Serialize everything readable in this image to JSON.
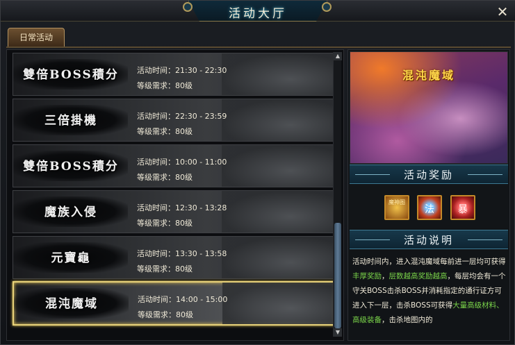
{
  "window": {
    "title": "活动大厅",
    "close_label": "✕"
  },
  "tabs": [
    {
      "label": "日常活动",
      "active": true
    }
  ],
  "activities": [
    {
      "name": "雙倍BOSS積分",
      "time": "活动时间：21:30 - 22:30",
      "level": "等级需求：80级",
      "selected": false
    },
    {
      "name": "三倍掛機",
      "time": "活动时间：22:30 - 23:59",
      "level": "等级需求：80级",
      "selected": false
    },
    {
      "name": "雙倍BOSS積分",
      "time": "活动时间：10:00 - 11:00",
      "level": "等级需求：80级",
      "selected": false
    },
    {
      "name": "魔族入侵",
      "time": "活动时间：12:30 - 13:28",
      "level": "等级需求：80级",
      "selected": false
    },
    {
      "name": "元寶龜",
      "time": "活动时间：13:30 - 13:58",
      "level": "等级需求：80级",
      "selected": false
    },
    {
      "name": "混沌魔域",
      "time": "活动时间：14:00 - 15:00",
      "level": "等级需求：80级",
      "selected": true
    }
  ],
  "detail": {
    "banner_title": "混沌魔域",
    "rewards_header": "活动奖励",
    "rewards": [
      {
        "label": "魔神图",
        "icon": "scroll-icon"
      },
      {
        "label": "法",
        "icon": "blue-orb-icon"
      },
      {
        "label": "暴",
        "icon": "red-orb-icon"
      }
    ],
    "description_header": "活动说明",
    "description": [
      {
        "text": "活动时间内，进入混沌魔域每前进一层均可获得",
        "highlight": false
      },
      {
        "text": "丰厚奖励",
        "highlight": true
      },
      {
        "text": "，",
        "highlight": false
      },
      {
        "text": "层数越高奖励越高",
        "highlight": true
      },
      {
        "text": "，每层均会有一个守关BOSS击杀BOSS并消耗指定的通行证方可进入下一层，击杀BOSS可获得",
        "highlight": false
      },
      {
        "text": "大量高级材料、高级装备",
        "highlight": true
      },
      {
        "text": "，击杀地图内的",
        "highlight": false
      }
    ]
  },
  "colors": {
    "selected_border": "#e8d27a",
    "highlight_text": "#7ad44a",
    "banner_title": "#ffd84a",
    "scroll_thumb": "#5f7b96"
  }
}
